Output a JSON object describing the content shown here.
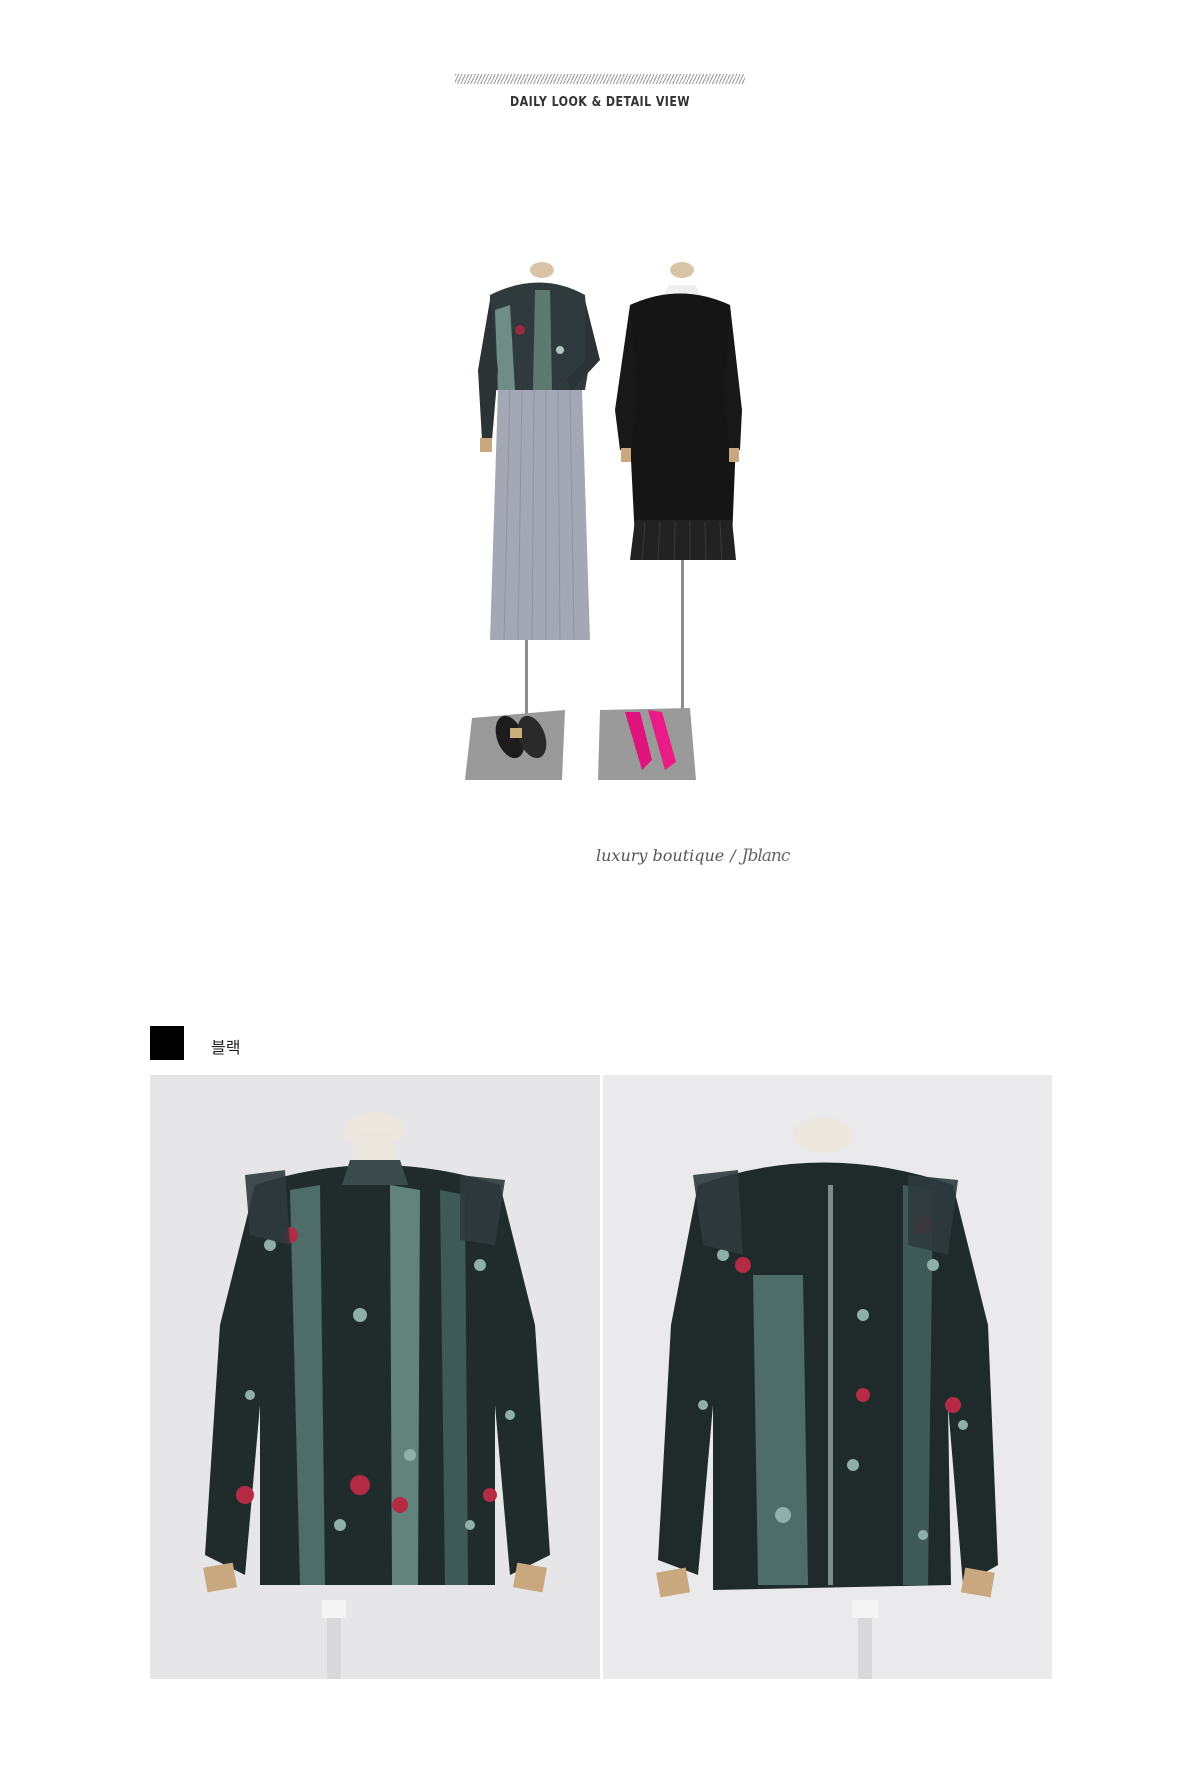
{
  "header": {
    "title": "DAILY LOOK & DETAIL VIEW"
  },
  "signature": {
    "text": "luxury boutique",
    "separator": "/",
    "brand_script": "Jblanc"
  },
  "color_section": {
    "swatch_color": "#000000",
    "color_name": "블랙"
  },
  "images": {
    "daily_look": "daily-look-mannequins",
    "detail_front": "blouse-front-view",
    "detail_back": "blouse-back-view"
  }
}
